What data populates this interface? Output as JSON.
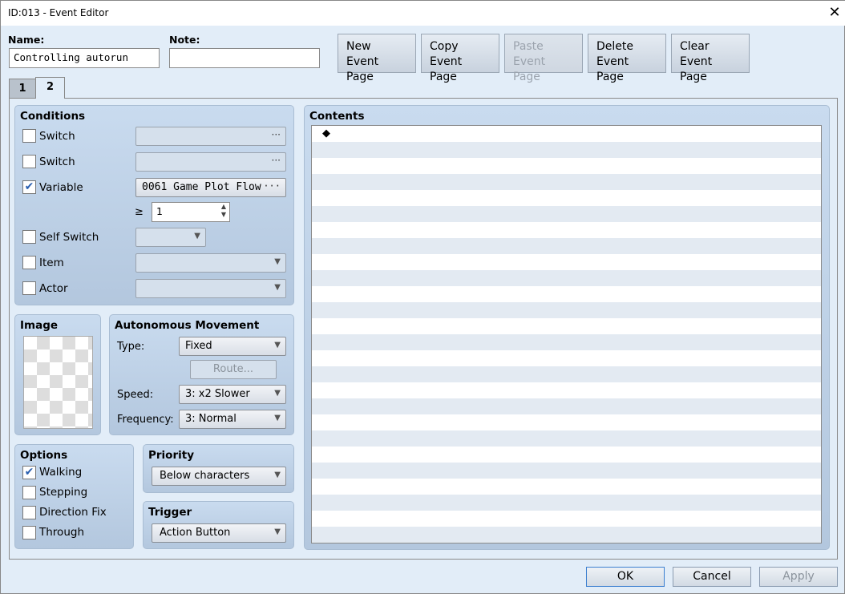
{
  "window": {
    "title": "ID:013 - Event Editor",
    "close": "✕"
  },
  "name": {
    "label": "Name:",
    "value": "Controlling autorun"
  },
  "note": {
    "label": "Note:",
    "value": ""
  },
  "toolbar": [
    {
      "l1": "New",
      "l2": "Event Page"
    },
    {
      "l1": "Copy",
      "l2": "Event Page"
    },
    {
      "l1": "Paste",
      "l2": "Event Page"
    },
    {
      "l1": "Delete",
      "l2": "Event Page"
    },
    {
      "l1": "Clear",
      "l2": "Event Page"
    }
  ],
  "tabs": [
    "1",
    "2"
  ],
  "conditions": {
    "title": "Conditions",
    "switch1": {
      "label": "Switch",
      "value": "",
      "checked": false
    },
    "switch2": {
      "label": "Switch",
      "value": "",
      "checked": false
    },
    "variable": {
      "label": "Variable",
      "value": "0061 Game Plot Flow",
      "checked": true,
      "op": "≥",
      "amount": "1"
    },
    "self_switch": {
      "label": "Self Switch",
      "value": ""
    },
    "item": {
      "label": "Item",
      "value": ""
    },
    "actor": {
      "label": "Actor",
      "value": ""
    },
    "check": "✔",
    "dots": "···",
    "arrow": "▼"
  },
  "image": {
    "title": "Image"
  },
  "movement": {
    "title": "Autonomous Movement",
    "type_label": "Type:",
    "type": "Fixed",
    "route": "Route...",
    "speed_label": "Speed:",
    "speed": "3: x2 Slower",
    "freq_label": "Frequency:",
    "freq": "3: Normal"
  },
  "options": {
    "title": "Options",
    "items": [
      {
        "label": "Walking",
        "checked": true
      },
      {
        "label": "Stepping"
      },
      {
        "label": "Direction Fix"
      },
      {
        "label": "Through"
      }
    ]
  },
  "priority": {
    "title": "Priority",
    "value": "Below characters"
  },
  "trigger": {
    "title": "Trigger",
    "value": "Action Button"
  },
  "contents": {
    "title": "Contents",
    "first_line": "◆"
  },
  "footer": {
    "ok": "OK",
    "cancel": "Cancel",
    "apply": "Apply"
  }
}
